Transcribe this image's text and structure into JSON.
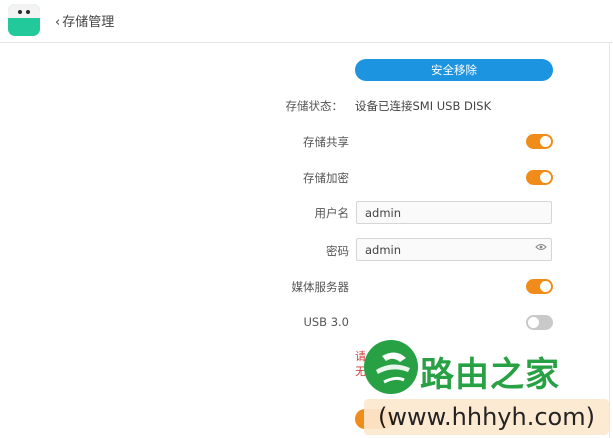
{
  "header": {
    "back_label": "存储管理"
  },
  "main": {
    "safe_remove_label": "安全移除",
    "status": {
      "label": "存储状态：",
      "value": "设备已连接SMI USB DISK"
    },
    "share": {
      "label": "存储共享",
      "on": true
    },
    "encrypt": {
      "label": "存储加密",
      "on": true
    },
    "username": {
      "label": "用户名",
      "value": "admin"
    },
    "password": {
      "label": "密码",
      "value": "admin"
    },
    "media_server": {
      "label": "媒体服务器",
      "on": true
    },
    "usb3": {
      "label": "USB 3.0",
      "on": false
    },
    "warning_line1": "请",
    "warning_line2": "无"
  },
  "watermark": {
    "brand": "路由之家",
    "url": "(www.hhhyh.com)"
  },
  "colors": {
    "accent_blue": "#1d94e0",
    "toggle_on": "#f08c1a",
    "toggle_off": "#c9c9c9",
    "warn_red": "#d23b3b",
    "watermark_green": "#27a143"
  }
}
